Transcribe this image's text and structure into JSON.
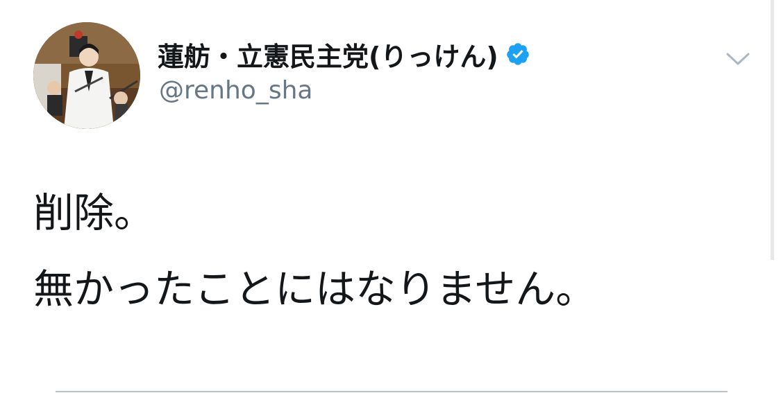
{
  "tweet": {
    "author": {
      "display_name": "蓮舫・立憲民主党(りっけん)",
      "handle": "@renho_sha",
      "verified": true
    },
    "text_lines": [
      "削除。",
      "無かったことにはなりません。"
    ]
  },
  "icons": {
    "verified": "verified-badge-icon",
    "menu": "chevron-down-icon"
  },
  "colors": {
    "text": "#14171a",
    "handle": "#657786",
    "verified": "#1da1f2",
    "caret": "#aab8c2"
  }
}
